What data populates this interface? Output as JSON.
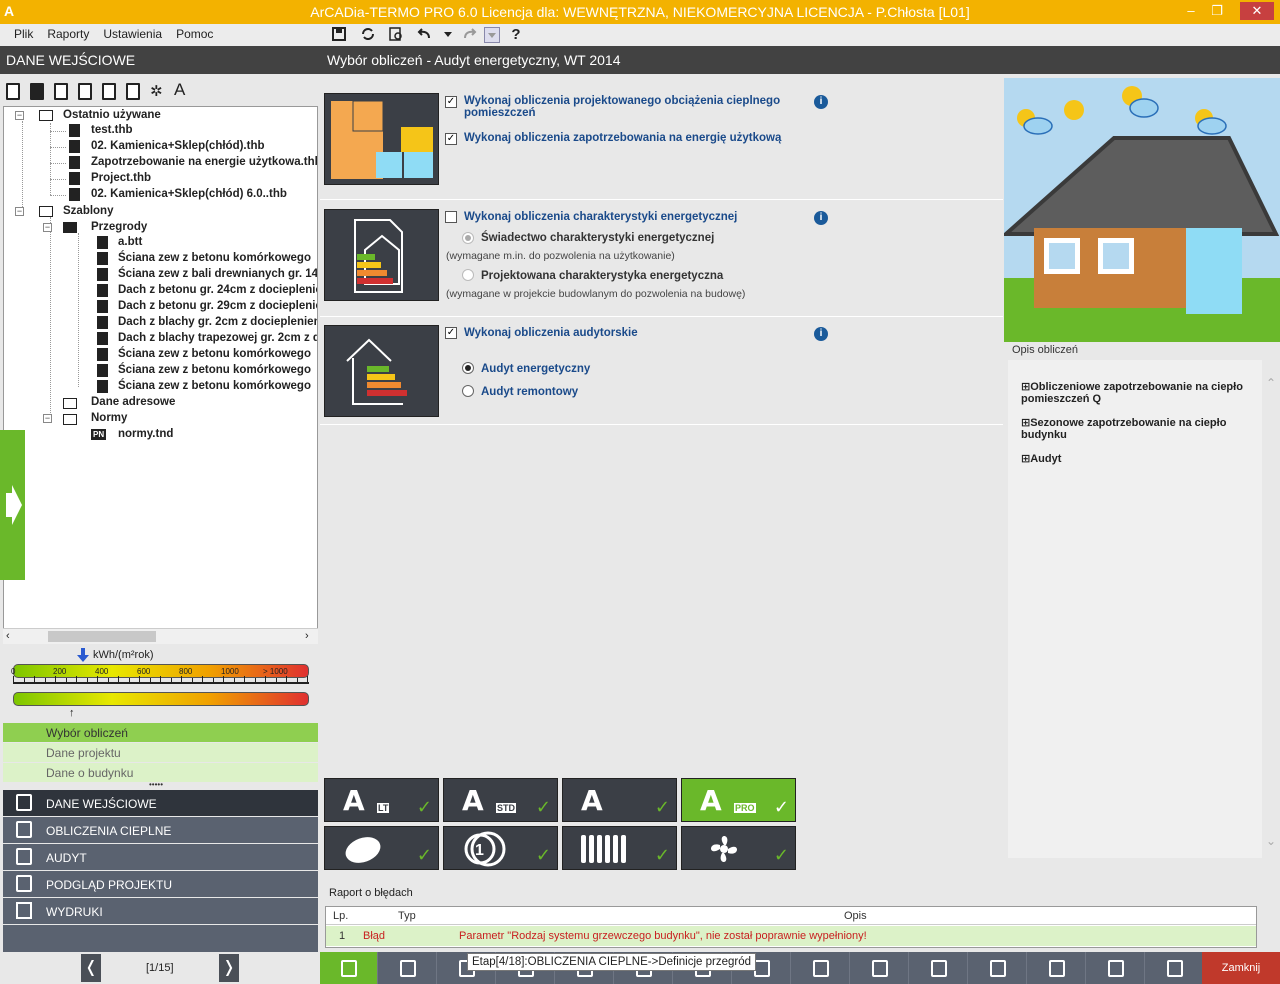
{
  "window": {
    "title": "ArCADia-TERMO PRO 6.0 Licencja dla: WEWNĘTRZNA, NIEKOMERCYJNA LICENCJA - P.Chłosta [L01]",
    "minimize": "–",
    "restore": "❐",
    "close": "✕",
    "logo": "A"
  },
  "menu": {
    "items": [
      "Plik",
      "Raporty",
      "Ustawienia",
      "Pomoc"
    ]
  },
  "toolbar": {
    "icons": [
      "save-icon",
      "refresh-icon",
      "preview-icon",
      "undo-icon",
      "dropdown-icon",
      "redo-icon",
      "dropdown-icon",
      "help-icon"
    ],
    "help": "?"
  },
  "left": {
    "header": "DANE WEJŚCIOWE"
  },
  "tree": {
    "recent_label": "Ostatnio używane",
    "recent": [
      "test.thb",
      "02. Kamienica+Sklep(chłód).thb",
      "Zapotrzebowanie na energie użytkowa.thb",
      "Project.thb",
      "02. Kamienica+Sklep(chłód) 6.0..thb"
    ],
    "templates_label": "Szablony",
    "partitions_label": "Przegrody",
    "partitions": [
      "a.btt",
      "Ściana zew z betonu komórkowego",
      "Ściana zew z bali drewnianych gr. 14",
      "Dach z betonu gr. 24cm z docieplenie",
      "Dach z betonu gr. 29cm z docieplenie",
      "Dach z blachy gr. 2cm z dociepleniem",
      "Dach z blachy trapezowej gr. 2cm z d",
      "Ściana zew z betonu komórkowego",
      "Ściana zew z betonu komórkowego",
      "Ściana zew z betonu komórkowego"
    ],
    "address_label": "Dane adresowe",
    "norms_label": "Normy",
    "norms": [
      "normy.tnd"
    ],
    "pn_badge": "PN"
  },
  "energy_scale": {
    "unit": "kWh/(m²rok)",
    "ticks": [
      "0",
      "200",
      "400",
      "600",
      "800",
      "1000",
      "> 1000"
    ],
    "marker_value": 330,
    "lower_marker": 300
  },
  "steps": [
    "Wybór obliczeń",
    "Dane projektu",
    "Dane o budynku"
  ],
  "steps_more": "•••••",
  "nav": [
    "DANE WEJŚCIOWE",
    "OBLICZENIA CIEPLNE",
    "AUDYT",
    "PODGLĄD PROJEKTU",
    "WYDRUKI"
  ],
  "pager": {
    "text": "[1/15]",
    "prev": "❬",
    "next": "❭"
  },
  "main": {
    "header": "Wybór obliczeń - Audyt energetyczny, WT 2014",
    "opt1": {
      "checked": true,
      "label": "Wykonaj obliczenia projektowanego obciążenia cieplnego pomieszczeń"
    },
    "opt2": {
      "checked": true,
      "label": "Wykonaj obliczenia zapotrzebowania na energię użytkową"
    },
    "opt3": {
      "checked": false,
      "label": "Wykonaj obliczenia charakterystyki energetycznej"
    },
    "radio1": {
      "label": "Świadectwo charakterystyki energetycznej",
      "note": "(wymagane m.in. do pozwolenia na użytkowanie)"
    },
    "radio2": {
      "label": "Projektowana charakterystyka energetyczna",
      "note": "(wymagane w projekcie budowlanym do pozwolenia na budowę)"
    },
    "opt4": {
      "checked": true,
      "label": "Wykonaj obliczenia audytorskie"
    },
    "radio3": {
      "label": "Audyt energetyczny"
    },
    "radio4": {
      "label": "Audyt remontowy"
    },
    "info": "i",
    "check_mark": "✓"
  },
  "modules": [
    {
      "name": "A",
      "sub": "LT",
      "active": false
    },
    {
      "name": "A",
      "sub": "STD",
      "active": false
    },
    {
      "name": "A",
      "sub": "",
      "active": false
    },
    {
      "name": "A",
      "sub": "PRO",
      "active": true
    },
    {
      "name": "leaf-icon",
      "sub": "",
      "active": false
    },
    {
      "name": "meter-icon",
      "sub": "",
      "active": false
    },
    {
      "name": "radiator-icon",
      "sub": "",
      "active": false
    },
    {
      "name": "fan-icon",
      "sub": "",
      "active": false
    }
  ],
  "opis": {
    "title": "Opis obliczeń",
    "items": [
      "Obliczeniowe zapotrzebowanie na ciepło pomieszczeń Q",
      "Sezonowe zapotrzebowanie na ciepło budynku",
      "Audyt"
    ]
  },
  "errors": {
    "title": "Raport o błędach",
    "headers": [
      "Lp.",
      "Typ",
      "Opis"
    ],
    "rows": [
      {
        "lp": "1",
        "typ": "Błąd",
        "opis": "Parametr \"Rodzaj systemu grzewczego budynku\", nie został poprawnie wypełniony!"
      }
    ]
  },
  "bottom": {
    "tooltip": "Etap[4/18]:OBLICZENIA CIEPLNE->Definicje przegród",
    "close_label": "Zamknij"
  },
  "colors": {
    "accent": "#6ab82a",
    "title": "#f3b200",
    "dark": "#3b3f46",
    "error": "#c82020",
    "close": "#c0392b"
  }
}
